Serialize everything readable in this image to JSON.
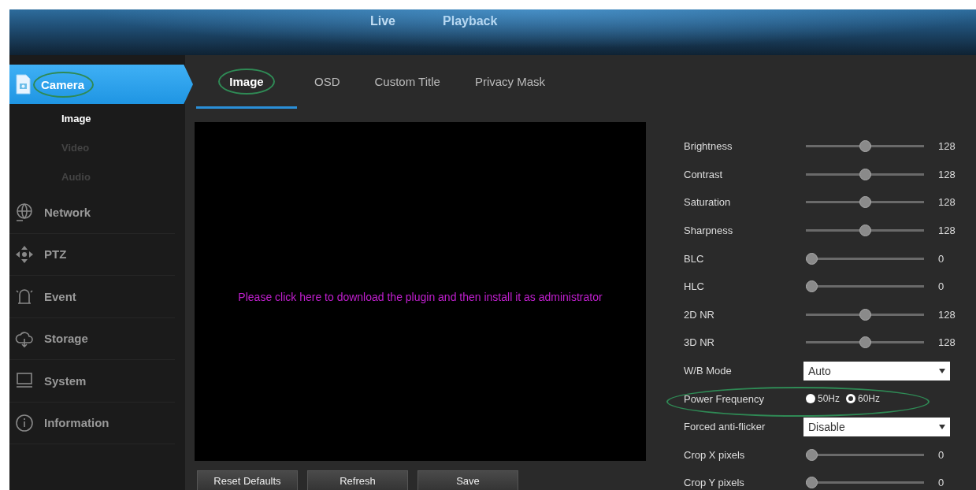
{
  "top_nav": [
    {
      "label": "Live"
    },
    {
      "label": "Playback"
    }
  ],
  "sidebar": {
    "items": [
      {
        "label": "Camera",
        "selected": true,
        "circled": true,
        "children": [
          {
            "label": "Image",
            "selected": true
          },
          {
            "label": "Video",
            "selected": false
          },
          {
            "label": "Audio",
            "selected": false
          }
        ]
      },
      {
        "label": "Network",
        "selected": false,
        "circled": false
      },
      {
        "label": "PTZ",
        "selected": false,
        "circled": false
      },
      {
        "label": "Event",
        "selected": false,
        "circled": false
      },
      {
        "label": "Storage",
        "selected": false,
        "circled": false
      },
      {
        "label": "System",
        "selected": false,
        "circled": false
      },
      {
        "label": "Information",
        "selected": false,
        "circled": false
      }
    ]
  },
  "tabs": [
    {
      "label": "Image",
      "selected": true,
      "circled": true
    },
    {
      "label": "OSD",
      "selected": false,
      "circled": false
    },
    {
      "label": "Custom Title",
      "selected": false,
      "circled": false
    },
    {
      "label": "Privacy Mask",
      "selected": false,
      "circled": false
    }
  ],
  "video": {
    "message": "Please click here to download the plugin and then install it as administrator"
  },
  "buttons": [
    "Reset Defaults",
    "Refresh",
    "Save"
  ],
  "settings": [
    {
      "kind": "slider",
      "label": "Brightness",
      "level": 0.5,
      "reading": "128"
    },
    {
      "kind": "slider",
      "label": "Contrast",
      "level": 0.5,
      "reading": "128"
    },
    {
      "kind": "slider",
      "label": "Saturation",
      "level": 0.5,
      "reading": "128"
    },
    {
      "kind": "slider",
      "label": "Sharpness",
      "level": 0.5,
      "reading": "128"
    },
    {
      "kind": "slider",
      "label": "BLC",
      "level": 0,
      "reading": "0"
    },
    {
      "kind": "slider",
      "label": "HLC",
      "level": 0,
      "reading": "0"
    },
    {
      "kind": "slider",
      "label": "2D NR",
      "level": 0.5,
      "reading": "128"
    },
    {
      "kind": "slider",
      "label": "3D NR",
      "level": 0.5,
      "reading": "128"
    },
    {
      "kind": "select",
      "label": "W/B Mode",
      "value": "Auto"
    },
    {
      "kind": "radio",
      "label": "Power Frequency",
      "circled": true,
      "options": [
        {
          "label": "50Hz",
          "selected": false
        },
        {
          "label": "60Hz",
          "selected": true
        }
      ]
    },
    {
      "kind": "select",
      "label": "Forced anti-flicker",
      "value": "Disable"
    },
    {
      "kind": "slider",
      "label": "Crop X pixels",
      "level": 0,
      "reading": "0"
    },
    {
      "kind": "slider",
      "label": "Crop Y pixels",
      "level": 0,
      "reading": "0"
    }
  ]
}
